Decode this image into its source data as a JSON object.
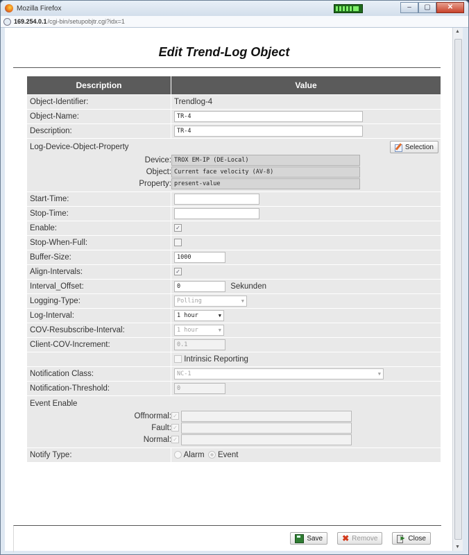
{
  "window": {
    "title": "Mozilla Firefox",
    "address": "169.254.0.1/cgi-bin/setupobjtr.cgi?idx=1",
    "address_host": "169.254.0.1",
    "address_path": "/cgi-bin/setupobjtr.cgi?idx=1"
  },
  "page": {
    "title": "Edit Trend-Log Object"
  },
  "table": {
    "headers": {
      "description": "Description",
      "value": "Value"
    },
    "object_identifier": {
      "label": "Object-Identifier:",
      "value": "Trendlog-4"
    },
    "object_name": {
      "label": "Object-Name:",
      "value": "TR-4"
    },
    "description": {
      "label": "Description:",
      "value": "TR-4"
    },
    "ldop": {
      "label": "Log-Device-Object-Property",
      "selection_label": "Selection",
      "device_label": "Device:",
      "device_value": "TROX EM-IP (DE-Local)",
      "object_label": "Object:",
      "object_value": "Current face velocity (AV-8)",
      "property_label": "Property:",
      "property_value": "present-value"
    },
    "start_time": {
      "label": "Start-Time:",
      "value": ""
    },
    "stop_time": {
      "label": "Stop-Time:",
      "value": ""
    },
    "enable": {
      "label": "Enable:",
      "checked": true
    },
    "stop_when_full": {
      "label": "Stop-When-Full:",
      "checked": false
    },
    "buffer_size": {
      "label": "Buffer-Size:",
      "value": "1000"
    },
    "align_intervals": {
      "label": "Align-Intervals:",
      "checked": true
    },
    "interval_offset": {
      "label": "Interval_Offset:",
      "value": "0",
      "unit": "Sekunden"
    },
    "logging_type": {
      "label": "Logging-Type:",
      "value": "Polling"
    },
    "log_interval": {
      "label": "Log-Interval:",
      "value": "1 hour"
    },
    "cov_resubscribe": {
      "label": "COV-Resubscribe-Interval:",
      "value": "1 hour"
    },
    "client_cov": {
      "label": "Client-COV-Increment:",
      "value": "0.1"
    },
    "intrinsic": {
      "label": "Intrinsic Reporting",
      "checked": false
    },
    "notification_class": {
      "label": "Notification Class:",
      "value": "NC-1"
    },
    "notification_threshold": {
      "label": "Notification-Threshold:",
      "value": "0"
    },
    "event_enable": {
      "label": "Event Enable",
      "offnormal_label": "Offnormal:",
      "fault_label": "Fault:",
      "normal_label": "Normal:"
    },
    "notify_type": {
      "label": "Notify Type:",
      "alarm": "Alarm",
      "event": "Event",
      "selected": "Event"
    }
  },
  "buttons": {
    "save": "Save",
    "remove": "Remove",
    "close": "Close"
  }
}
